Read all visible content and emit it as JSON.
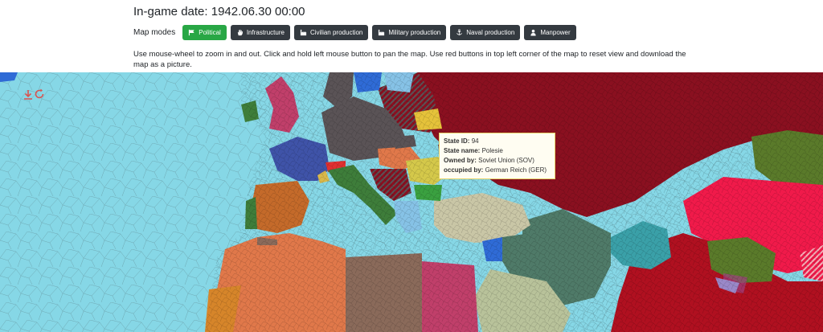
{
  "header": {
    "date_label": "In-game date:",
    "date_value": "1942.06.30 00:00",
    "modes_label": "Map modes",
    "modes": [
      {
        "label": "Political",
        "icon": "flag-icon",
        "active": true
      },
      {
        "label": "Infrastructure",
        "icon": "hand-icon",
        "active": false
      },
      {
        "label": "Civilian production",
        "icon": "factory-icon",
        "active": false
      },
      {
        "label": "Military production",
        "icon": "factory-icon",
        "active": false
      },
      {
        "label": "Naval production",
        "icon": "anchor-icon",
        "active": false
      },
      {
        "label": "Manpower",
        "icon": "person-icon",
        "active": false
      }
    ],
    "help_text": "Use mouse-wheel to zoom in and out. Click and hold left mouse button to pan the map. Use red buttons in top left corner of the map to reset view and download the map as a picture."
  },
  "map": {
    "controls": [
      {
        "name": "download-icon",
        "color": "#d9534f"
      },
      {
        "name": "reset-view-icon",
        "color": "#d9534f"
      }
    ],
    "tooltip": {
      "state_id_label": "State ID:",
      "state_id": "94",
      "state_name_label": "State name:",
      "state_name": "Polesie",
      "owned_by_label": "Owned by:",
      "owned_by": "Soviet Union (SOV)",
      "occupied_by_label": "occupied by:",
      "occupied_by": "German Reich (GER)"
    },
    "colors": {
      "sea": "#86d7e6",
      "soviet": "#8a1020",
      "germany": "#5a5356",
      "italy": "#3e7d3a",
      "france": "#3f53a8",
      "uk": "#c03f6a",
      "spain": "#c46a2a",
      "africa_orange": "#e0784a",
      "africa_brown": "#8a6a5a",
      "egypt": "#b8c29a",
      "turkey": "#c9c6a6",
      "iran": "#4f7a68",
      "china_red": "#f01a4a",
      "mongolia_green": "#5a7a2a",
      "afghanistan_teal": "#3aa0a8"
    }
  }
}
